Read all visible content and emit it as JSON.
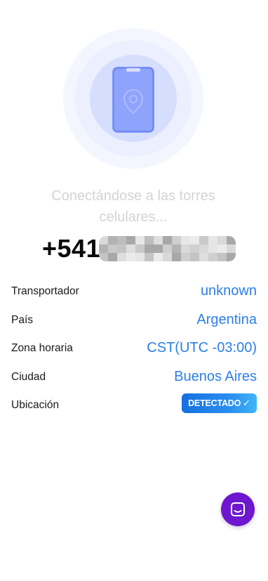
{
  "status": {
    "line1": "Conectándose a las torres",
    "line2": "celulares..."
  },
  "phone": {
    "prefix": "+541"
  },
  "info": {
    "carrier_label": "Transportador",
    "carrier_value": "unknown",
    "country_label": "País",
    "country_value": "Argentina",
    "timezone_label": "Zona horaria",
    "timezone_value": "CST(UTC -03:00)",
    "city_label": "Ciudad",
    "city_value": "Buenos Aires",
    "location_label": "Ubicación",
    "location_badge": "DETECTADO",
    "location_badge_check": "✓"
  },
  "colors": {
    "accent": "#2d7ee8",
    "chat_button": "#6d17cf",
    "status_text": "#d3d3d8"
  },
  "icons": {
    "hero": "phone-location-icon",
    "chat": "chat-icon"
  }
}
